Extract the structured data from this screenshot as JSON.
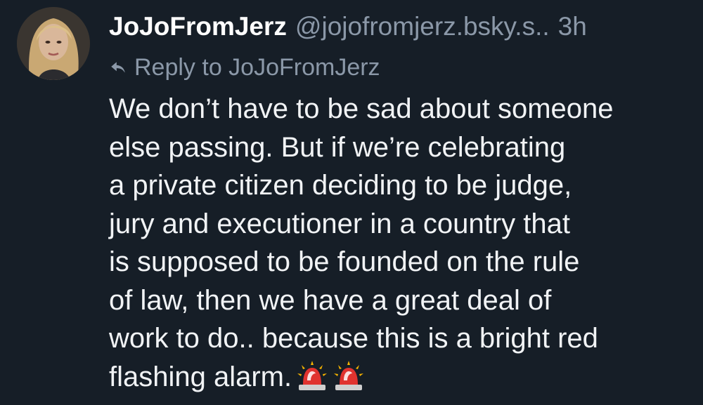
{
  "post": {
    "author": {
      "display_name": "JoJoFromJerz",
      "handle": "@jojofromjerz.bsky.s..",
      "avatar_icon": "profile-photo"
    },
    "time": "3h",
    "reply_to": "Reply to JoJoFromJerz",
    "body_lines": [
      "We don’t have to be sad about someone",
      "else passing. But if we’re celebrating",
      "a private citizen deciding to be judge,",
      "jury and executioner in a country that",
      "is supposed to be founded on the rule",
      "of law, then we have a great deal of",
      "work to do.. because this is a bright red",
      "flashing alarm."
    ],
    "emojis": [
      "🚨",
      "🚨"
    ]
  },
  "colors": {
    "background": "#161e27",
    "text": "#f1f3f5",
    "muted": "#8b98a8",
    "alarm_red": "#e0332f"
  }
}
